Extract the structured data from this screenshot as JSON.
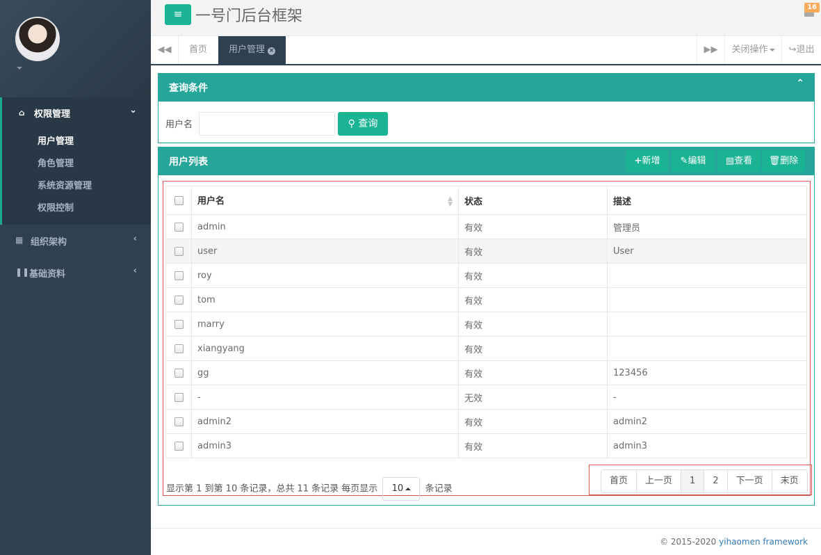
{
  "header": {
    "app_title": "一号门后台框架",
    "menu_icon": "hamburger-icon",
    "mail_count": "16"
  },
  "sidebar": {
    "groups": [
      {
        "label": "权限管理",
        "icon": "home-icon",
        "expanded": true,
        "items": [
          "用户管理",
          "角色管理",
          "系统资源管理",
          "权限控制"
        ],
        "active": "用户管理"
      },
      {
        "label": "组织架构",
        "icon": "table-icon",
        "expanded": false
      },
      {
        "label": "基础资料",
        "icon": "cutlery-icon",
        "expanded": false
      }
    ]
  },
  "tabs": {
    "home": "首页",
    "active": "用户管理",
    "close_ops": "关闭操作",
    "logout": "退出"
  },
  "query": {
    "title": "查询条件",
    "label": "用户名",
    "input_value": "",
    "button": "查询"
  },
  "list": {
    "title": "用户列表",
    "buttons": {
      "add": "新增",
      "edit": "编辑",
      "view": "查看",
      "delete": "删除"
    },
    "columns": [
      "用户名",
      "状态",
      "描述"
    ],
    "rows": [
      [
        "admin",
        "有效",
        "管理员"
      ],
      [
        "user",
        "有效",
        "User"
      ],
      [
        "roy",
        "有效",
        ""
      ],
      [
        "tom",
        "有效",
        ""
      ],
      [
        "marry",
        "有效",
        ""
      ],
      [
        "xiangyang",
        "有效",
        ""
      ],
      [
        "gg",
        "有效",
        "123456"
      ],
      [
        "-",
        "无效",
        "-"
      ],
      [
        "admin2",
        "有效",
        "admin2"
      ],
      [
        "admin3",
        "有效",
        "admin3"
      ]
    ]
  },
  "pagination": {
    "info_prefix": "显示第 1 到第 10 条记录，总共 11 条记录 每页显示",
    "page_size": "10",
    "info_suffix": "条记录",
    "first": "首页",
    "prev": "上一页",
    "pages": [
      "1",
      "2"
    ],
    "current": "1",
    "next": "下一页",
    "last": "末页"
  },
  "footer": {
    "copyright": "© 2015-2020",
    "link": "yihaomen framework"
  },
  "colors": {
    "accent": "#1ab394",
    "panel": "#26a69a",
    "sidebar": "#2f4050"
  }
}
